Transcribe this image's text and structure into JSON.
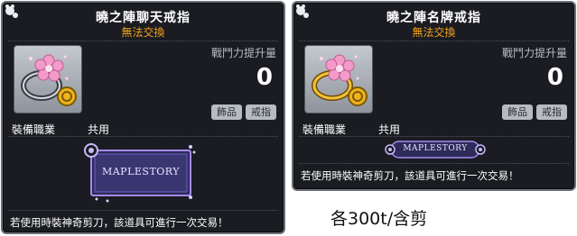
{
  "cards": [
    {
      "title": "曉之陣聊天戒指",
      "subtitle": "無法交換",
      "stat_label": "戰鬥力提升量",
      "stat_value": "0",
      "tags": [
        "飾品",
        "戒指"
      ],
      "job_label": "裝備職業",
      "job_value": "共用",
      "frame_text": "MAPLESTORY",
      "notice": "若使用時裝神奇剪刀，該道具可進行一次交易！"
    },
    {
      "title": "曉之陣名牌戒指",
      "subtitle": "無法交換",
      "stat_label": "戰鬥力提升量",
      "stat_value": "0",
      "tags": [
        "飾品",
        "戒指"
      ],
      "job_label": "裝備職業",
      "job_value": "共用",
      "frame_text": "MAPLESTORY",
      "notice": "若使用時裝神奇剪刀，該道具可進行一次交易！"
    }
  ],
  "caption": "各300t/含剪",
  "colors": {
    "tooltip_bg": "#1a1c21",
    "subtitle": "#f4a21b",
    "tag_bg": "#b7bbc2",
    "frame_accent": "#a58bf0"
  },
  "icons": [
    "cat-paw-corner-icon",
    "flower-ring-icon",
    "gold-coin-icon"
  ]
}
